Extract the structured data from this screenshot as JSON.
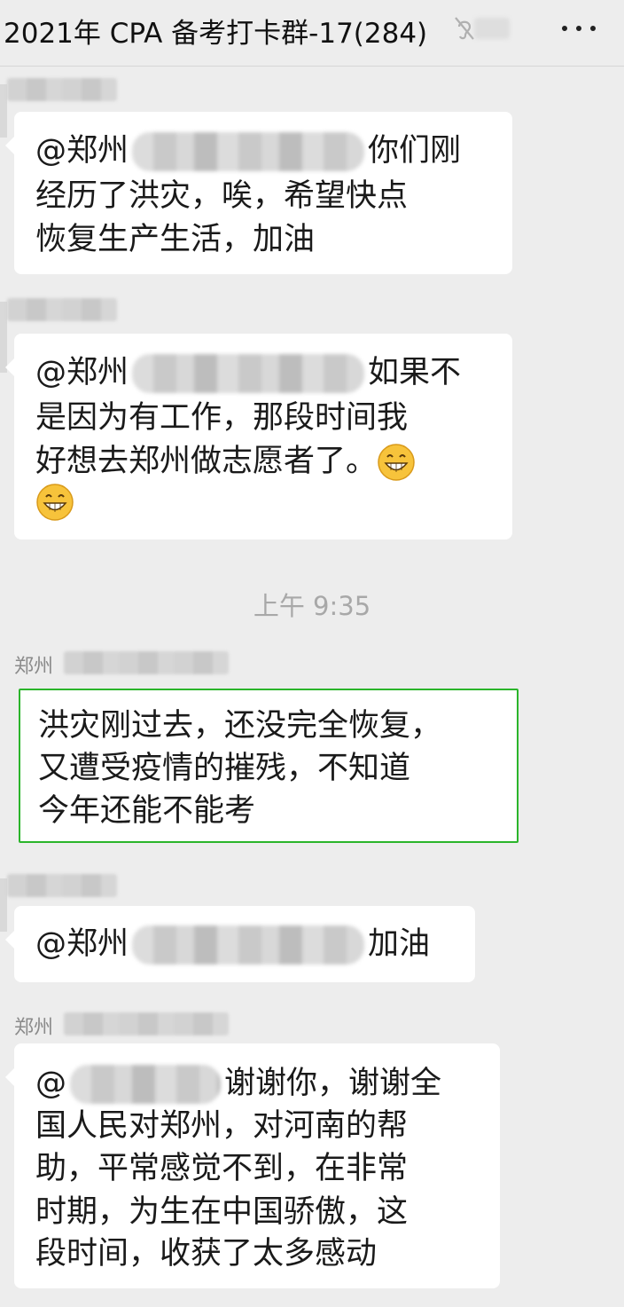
{
  "header": {
    "title": "2021年 CPA 备考打卡群-17(284)",
    "mute_icon": "ear-off-icon",
    "more_icon": "ellipsis-icon"
  },
  "messages": [
    {
      "lines": [
        "@郑州",
        "你们刚",
        "经历了洪灾，唉，希望快点",
        "恢复生产生活，加油"
      ]
    },
    {
      "lines": [
        "@郑州",
        "如果不",
        "是因为有工作，那段时间我",
        "好想去郑州做志愿者了。"
      ],
      "emoji": "grinning-face-emoji"
    },
    {
      "timestamp": "上午 9:35"
    },
    {
      "sender": "郑州",
      "lines": [
        "洪灾刚过去，还没完全恢复，",
        "又遭受疫情的摧残，不知道",
        "今年还能不能考"
      ]
    },
    {
      "lines": [
        "@郑州",
        "加油"
      ]
    },
    {
      "sender": "郑州",
      "lines": [
        "@",
        "谢谢你，谢谢全",
        "国人民对郑州，对河南的帮",
        "助，平常感觉不到，在非常",
        "时期，为生在中国骄傲，这",
        "段时间，收获了太多感动"
      ]
    }
  ],
  "colors": {
    "background": "#ededed",
    "bubble": "#ffffff",
    "selected_border": "#2bb52b",
    "text": "#1a1a1a",
    "meta": "#a8a8a8"
  }
}
